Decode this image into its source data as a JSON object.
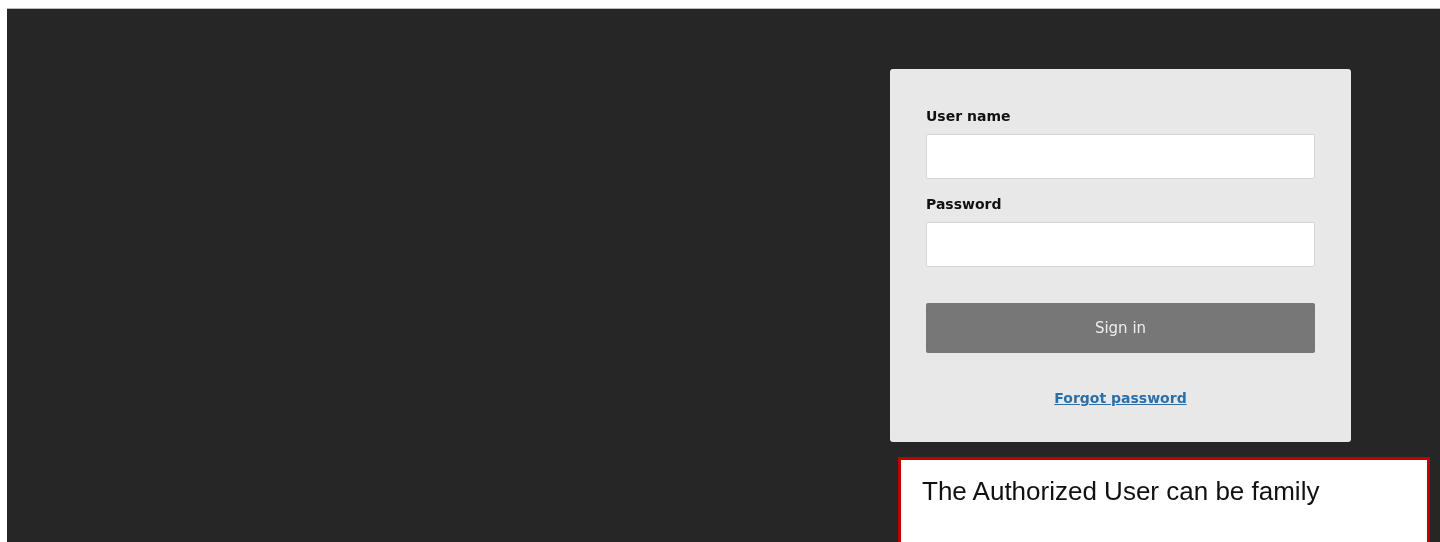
{
  "login_form": {
    "fields": [
      {
        "label": "User name"
      },
      {
        "label": "Password"
      }
    ],
    "submit_button": "Sign in",
    "forgot_link": "Forgot password"
  },
  "callout": {
    "text": "The Authorized User can be family"
  }
}
